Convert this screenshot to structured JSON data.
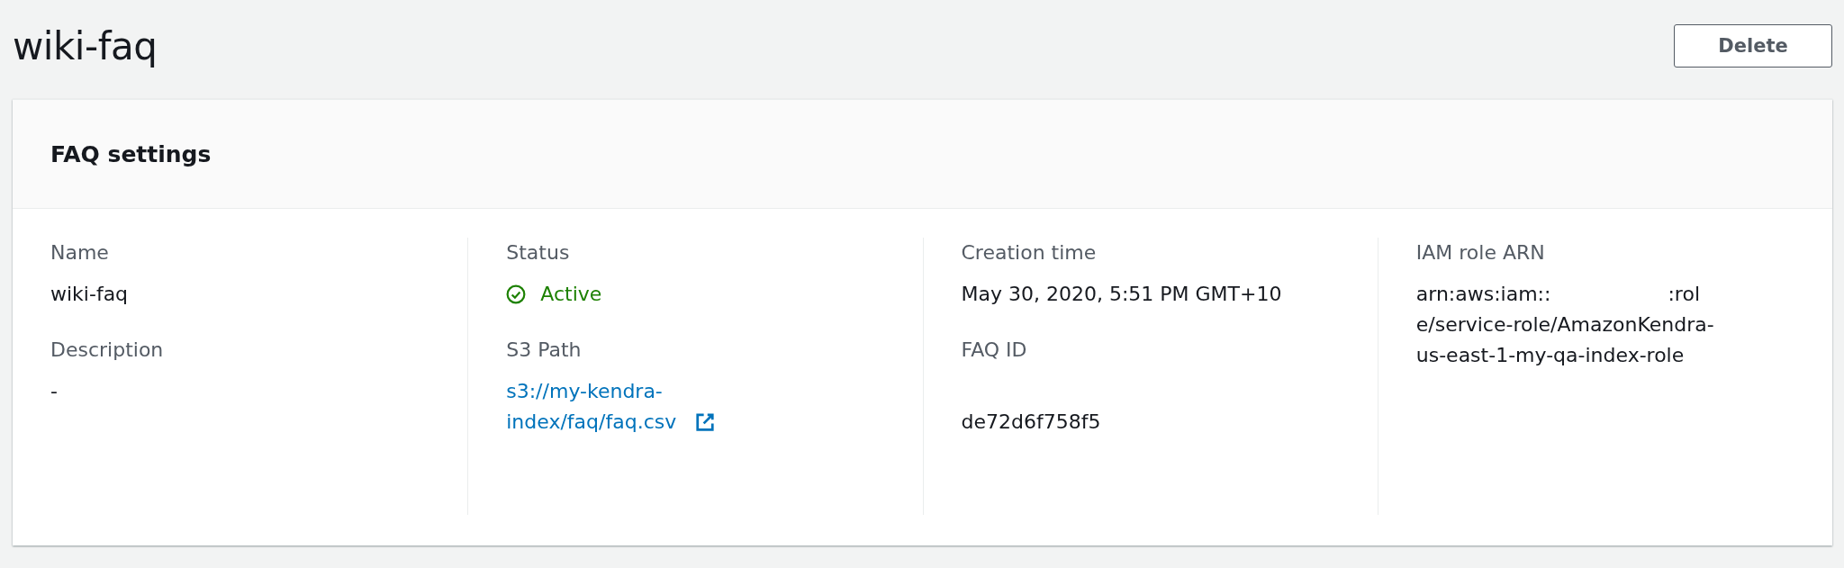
{
  "page": {
    "title": "wiki-faq",
    "buttons": [
      {
        "label": "Delete"
      }
    ]
  },
  "panel": {
    "title": "FAQ settings",
    "columns": [
      {
        "fields": [
          {
            "label": "Name",
            "kind": "text",
            "value": "wiki-faq"
          },
          {
            "label": "Description",
            "kind": "text",
            "value": "-"
          }
        ]
      },
      {
        "fields": [
          {
            "label": "Status",
            "kind": "status",
            "value": "Active"
          },
          {
            "label": "S3 Path",
            "kind": "link",
            "value": "s3://my-kendra-index/faq/faq.csv"
          }
        ]
      },
      {
        "fields": [
          {
            "label": "Creation time",
            "kind": "text",
            "value": "May 30, 2020, 5:51 PM GMT+10"
          },
          {
            "label": "FAQ ID",
            "kind": "redacted",
            "value": "de72d6f758f5"
          }
        ]
      },
      {
        "fields": [
          {
            "label": "IAM role ARN",
            "kind": "arn",
            "value_start": "arn:aws:iam::",
            "value": ":role/service-role/AmazonKendra-us-east-1-my-qa-index-role"
          }
        ]
      }
    ]
  }
}
